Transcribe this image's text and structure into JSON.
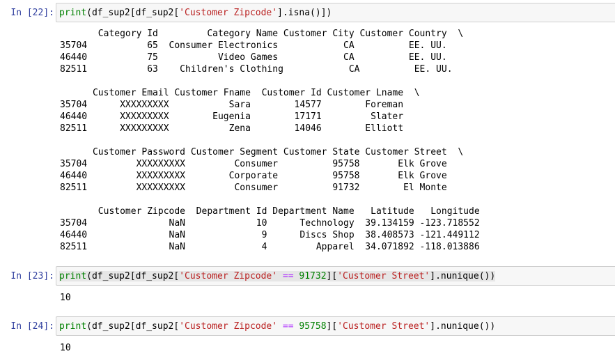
{
  "cells": [
    {
      "prompt": "In [22]:",
      "code": {
        "p1": "print",
        "p2": "(df_sup2[df_sup2[",
        "s1": "'Customer Zipcode'",
        "p3": "].isna()])"
      },
      "output_lines": [
        "       Category Id         Category Name Customer City Customer Country  \\",
        "35704           65  Consumer Electronics            CA          EE. UU.",
        "46440           75           Video Games            CA          EE. UU.",
        "82511           63    Children's Clothing            CA          EE. UU.",
        "",
        "      Customer Email Customer Fname  Customer Id Customer Lname  \\",
        "35704      XXXXXXXXX           Sara        14577        Foreman",
        "46440      XXXXXXXXX        Eugenia        17171         Slater",
        "82511      XXXXXXXXX           Zena        14046        Elliott",
        "",
        "      Customer Password Customer Segment Customer State Customer Street  \\",
        "35704         XXXXXXXXX         Consumer          95758       Elk Grove",
        "46440         XXXXXXXXX        Corporate          95758       Elk Grove",
        "82511         XXXXXXXXX         Consumer          91732        El Monte",
        "",
        "       Customer Zipcode  Department Id Department Name   Latitude   Longitude",
        "35704               NaN             10      Technology  39.134159 -123.718552",
        "46440               NaN              9      Discs Shop  38.408573 -121.449112",
        "82511               NaN              4         Apparel  34.071892 -118.013886"
      ]
    },
    {
      "prompt": "In [23]:",
      "code": {
        "p1": "print",
        "p2": "(df_sup2[df_sup2[",
        "s1": "'Customer Zipcode'",
        "o1": " == ",
        "n1": "91732",
        "p3": "][",
        "s2": "'Customer Street'",
        "p4": "].nunique())"
      },
      "output": "10"
    },
    {
      "prompt": "In [24]:",
      "code": {
        "p1": "print",
        "p2": "(df_sup2[df_sup2[",
        "s1": "'Customer Zipcode'",
        "o1": " == ",
        "n1": "95758",
        "p3": "][",
        "s2": "'Customer Street'",
        "p4": "].nunique())"
      },
      "output": "10"
    }
  ]
}
